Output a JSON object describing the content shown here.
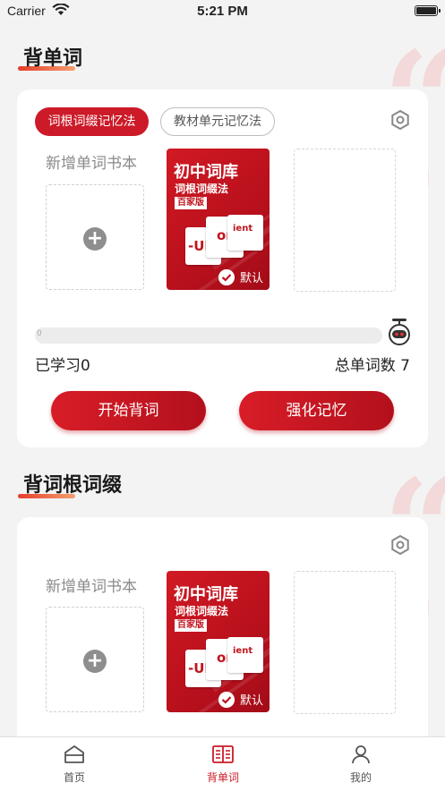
{
  "status_bar": {
    "carrier": "Carrier",
    "time": "5:21 PM"
  },
  "section1": {
    "title": "背单词",
    "tabs": [
      "词根词缀记忆法",
      "教材单元记忆法"
    ],
    "add_label": "新增单词书本",
    "book": {
      "title": "初中词库",
      "subtitle": "词根词缀法",
      "badge": "百家版",
      "sheet_up": "-UP",
      "sheet_on": "on",
      "sheet_ient": "ient",
      "default_label": "默认"
    },
    "progress": {
      "percent_text": "0",
      "value": 0
    },
    "learned": "已学习0",
    "total": "总单词数  7",
    "buttons": {
      "start": "开始背词",
      "reinforce": "强化记忆"
    }
  },
  "section2": {
    "title": "背词根词缀",
    "add_label": "新增单词书本",
    "book": {
      "title": "初中词库",
      "subtitle": "词根词缀法",
      "badge": "百家版",
      "sheet_up": "-UP",
      "sheet_on": "on",
      "sheet_ient": "ient",
      "default_label": "默认"
    }
  },
  "tab_bar": {
    "home": "首页",
    "words": "背单词",
    "mine": "我的"
  },
  "colors": {
    "accent": "#cc1a28",
    "background": "#f3f3f3"
  }
}
